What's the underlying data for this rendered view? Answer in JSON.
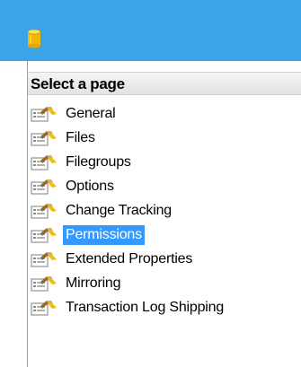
{
  "window": {
    "icon": "database-icon",
    "colors": {
      "titlebar": "#3aa4e6",
      "selection": "#3399ff"
    }
  },
  "panel": {
    "header": "Select a page",
    "item_icon": "property-page-icon",
    "selected_index": 5,
    "items": [
      {
        "label": "General"
      },
      {
        "label": "Files"
      },
      {
        "label": "Filegroups"
      },
      {
        "label": "Options"
      },
      {
        "label": "Change Tracking"
      },
      {
        "label": "Permissions"
      },
      {
        "label": "Extended Properties"
      },
      {
        "label": "Mirroring"
      },
      {
        "label": "Transaction Log Shipping"
      }
    ]
  }
}
